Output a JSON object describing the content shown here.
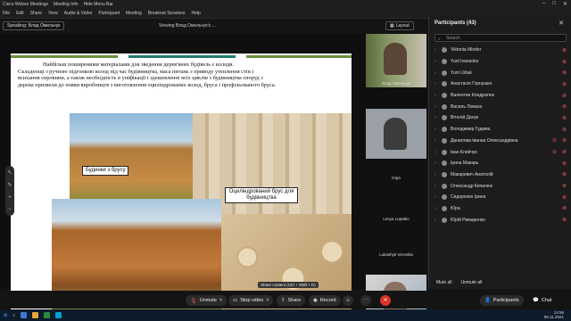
{
  "window": {
    "app_title": "Cisco Webex Meetings",
    "meeting_info": "Meeting Info",
    "hide_menu_bar": "Hide Menu Bar"
  },
  "menu": [
    "File",
    "Edit",
    "Share",
    "View",
    "Audio & Video",
    "Participant",
    "Meeting",
    "Breakout Sessions",
    "Help"
  ],
  "stage": {
    "speaking": "Speaking: Влад Омельчук",
    "viewing": "Viewing Влад Омельчук's ...",
    "layout_label": "Layout"
  },
  "slide": {
    "line1": "Найбільш поширеними матеріалами для зведення дерев'яних будівель є колоди.",
    "line2": "Складнощі з ручною підгонкою колод під час будівництва, маса питань з приводу утеплення стін і",
    "line3": "всихання сировини, а також необхідність в уніфікації і здешевленні всіх циклів з будівництва споруд з",
    "line4": "дерева призвели до появи виробництв з виготовлення оциліндрованих колод, бруса і профільованого бруса.",
    "caption1": "Будинки з брусу",
    "caption2": "Оциліндрований брус для будівництва",
    "bar_colors": [
      "#6b8f3f",
      "#ffffff",
      "#1f7a6e",
      "#ffffff",
      "#6b8f3f"
    ]
  },
  "videos": [
    {
      "name": "Влад Омельчук"
    },
    {
      "name": ""
    },
    {
      "name": "Юра"
    },
    {
      "name": "Lesya Lopatko"
    },
    {
      "name": "Lukashyk Veronika"
    },
    {
      "name": ""
    }
  ],
  "panel": {
    "title": "Participants (43)",
    "search_placeholder": "Search",
    "participants": [
      {
        "name": "Viktoriia Minder",
        "cam_off": false
      },
      {
        "name": "Yurii Ivanenko",
        "cam_off": false
      },
      {
        "name": "Yurii Urliuk",
        "cam_off": false
      },
      {
        "name": "Анастасія Горнушко",
        "cam_off": false
      },
      {
        "name": "Валентин Кондратюк",
        "cam_off": false
      },
      {
        "name": "Василь Ломага",
        "cam_off": false
      },
      {
        "name": "Віталій Данук",
        "cam_off": false
      },
      {
        "name": "Володимир Гудима",
        "cam_off": false
      },
      {
        "name": "Данилова Іванна Олександрівна",
        "cam_off": true
      },
      {
        "name": "Іван Клейчук",
        "cam_off": true
      },
      {
        "name": "Ірина Макарь",
        "cam_off": false
      },
      {
        "name": "Макаревич Анатолій",
        "cam_off": false
      },
      {
        "name": "Олександр Кичилюк",
        "cam_off": false
      },
      {
        "name": "Сидоренко Ірина",
        "cam_off": false
      },
      {
        "name": "Юра",
        "cam_off": false
      },
      {
        "name": "Юрій Римаренко",
        "cam_off": false
      }
    ],
    "mute_all": "Mute all",
    "unmute_all": "Unmute all"
  },
  "controls": {
    "unmute": "Unmute",
    "stop_video": "Stop video",
    "share": "Share",
    "record": "Record",
    "participants": "Participants",
    "chat": "Chat",
    "tooltip": "Share content (Ctrl + Shift + D)"
  },
  "clock": {
    "time": "14:56",
    "date": "09.11.2021"
  },
  "colors": {
    "accent_green": "#6b8f3f",
    "accent_teal": "#1f7a6e",
    "leave_red": "#d9342b",
    "muted_red": "#e05555"
  }
}
